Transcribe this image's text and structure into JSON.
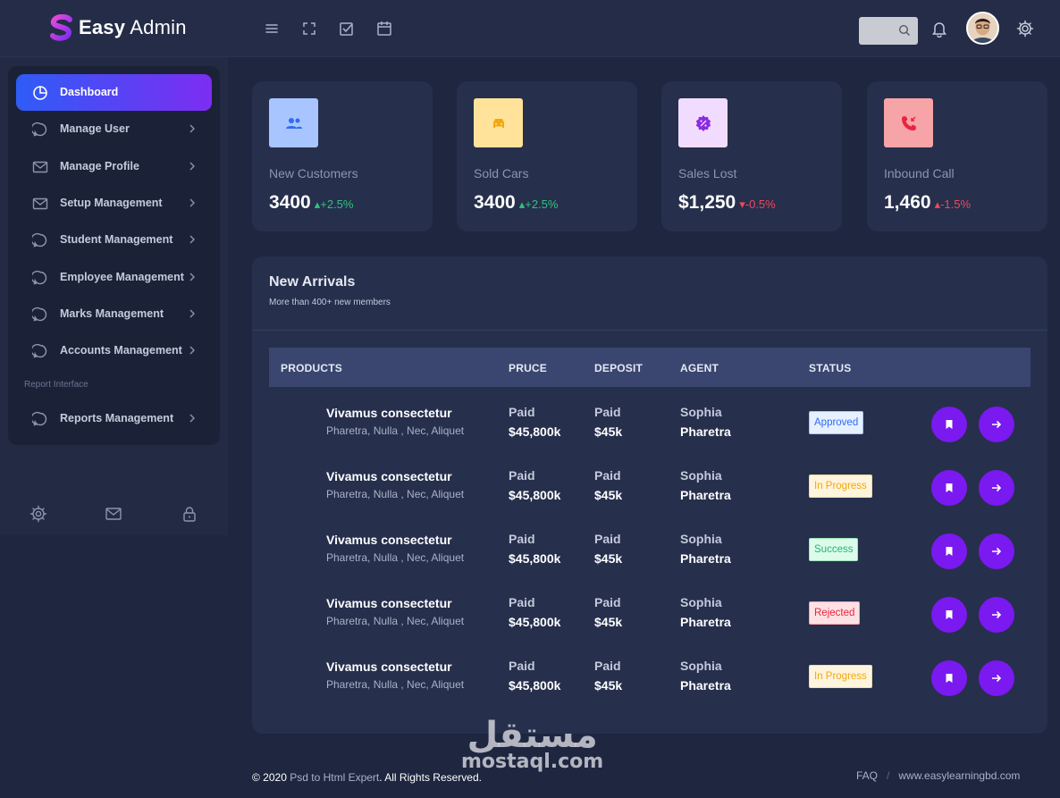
{
  "brand": {
    "bold": "Easy",
    "rest": "Admin"
  },
  "topbar": {
    "search_placeholder": ""
  },
  "sidebar": {
    "items": [
      {
        "label": "Dashboard",
        "icon": "pie-chart-icon",
        "active": true
      },
      {
        "label": "Manage User",
        "icon": "chat-icon"
      },
      {
        "label": "Manage Profile",
        "icon": "mail-icon"
      },
      {
        "label": "Setup Management",
        "icon": "mail-icon"
      },
      {
        "label": "Student Management",
        "icon": "chat-icon"
      },
      {
        "label": "Employee Management",
        "icon": "chat-icon"
      },
      {
        "label": "Marks Management",
        "icon": "chat-icon"
      },
      {
        "label": "Accounts Management",
        "icon": "chat-icon"
      }
    ],
    "section_label": "Report Interface",
    "report_item": {
      "label": "Reports Management",
      "icon": "chat-icon"
    }
  },
  "cards": [
    {
      "label": "New Customers",
      "value": "3400",
      "delta": "+2.5%",
      "trend": "up",
      "icon": "users-icon",
      "icon_bg": "#a8c5ff",
      "icon_color": "#2f6cf0"
    },
    {
      "label": "Sold Cars",
      "value": "3400",
      "delta": "+2.5%",
      "trend": "up",
      "icon": "car-icon",
      "icon_bg": "#ffe39a",
      "icon_color": "#f0a912"
    },
    {
      "label": "Sales Lost",
      "value": "$1,250",
      "delta": "-0.5%",
      "trend": "down",
      "icon": "discount-badge-icon",
      "icon_bg": "#f1dcff",
      "icon_color": "#8a2be2"
    },
    {
      "label": "Inbound Call",
      "value": "1,460",
      "delta": "-1.5%",
      "trend": "up-red",
      "icon": "incoming-call-icon",
      "icon_bg": "#f7a4a8",
      "icon_color": "#e8243f"
    }
  ],
  "panel": {
    "title": "New Arrivals",
    "subtitle": "More than 400+ new members",
    "headers": [
      "PRODUCTS",
      "PRUCE",
      "DEPOSIT",
      "AGENT",
      "STATUS"
    ],
    "rows": [
      {
        "name": "Vivamus consectetur",
        "sub": "Pharetra, Nulla , Nec, Aliquet",
        "price_top": "Paid",
        "price": "$45,800k",
        "dep_top": "Paid",
        "deposit": "$45k",
        "agent_first": "Sophia",
        "agent_last": "Pharetra",
        "status": "Approved",
        "status_type": "approved"
      },
      {
        "name": "Vivamus consectetur",
        "sub": "Pharetra, Nulla , Nec, Aliquet",
        "price_top": "Paid",
        "price": "$45,800k",
        "dep_top": "Paid",
        "deposit": "$45k",
        "agent_first": "Sophia",
        "agent_last": "Pharetra",
        "status": "In Progress",
        "status_type": "progress"
      },
      {
        "name": "Vivamus consectetur",
        "sub": "Pharetra, Nulla , Nec, Aliquet",
        "price_top": "Paid",
        "price": "$45,800k",
        "dep_top": "Paid",
        "deposit": "$45k",
        "agent_first": "Sophia",
        "agent_last": "Pharetra",
        "status": "Success",
        "status_type": "success"
      },
      {
        "name": "Vivamus consectetur",
        "sub": "Pharetra, Nulla , Nec, Aliquet",
        "price_top": "Paid",
        "price": "$45,800k",
        "dep_top": "Paid",
        "deposit": "$45k",
        "agent_first": "Sophia",
        "agent_last": "Pharetra",
        "status": "Rejected",
        "status_type": "rejected"
      },
      {
        "name": "Vivamus consectetur",
        "sub": "Pharetra, Nulla , Nec, Aliquet",
        "price_top": "Paid",
        "price": "$45,800k",
        "dep_top": "Paid",
        "deposit": "$45k",
        "agent_first": "Sophia",
        "agent_last": "Pharetra",
        "status": "In Progress",
        "status_type": "progress"
      }
    ]
  },
  "status_colors": {
    "approved": {
      "bg": "#e6f0ff",
      "fg": "#2f6cf0"
    },
    "progress": {
      "bg": "#fff4dc",
      "fg": "#f0a912"
    },
    "success": {
      "bg": "#dcfbe9",
      "fg": "#1fb870"
    },
    "rejected": {
      "bg": "#ffe1e4",
      "fg": "#e8243f"
    }
  },
  "footer": {
    "prefix": "© 2020",
    "link": "Psd to Html Expert",
    "suffix": ". All Rights Reserved.",
    "faq": "FAQ",
    "separator": "/",
    "site": "www.easylearningbd.com"
  },
  "watermark": {
    "arabic": "مستقل",
    "latin": "mostaql.com"
  },
  "colors": {
    "accent_gradient_start": "#2e5cf7",
    "accent_gradient_end": "#7d2df1",
    "action_button": "#7a19f0"
  }
}
